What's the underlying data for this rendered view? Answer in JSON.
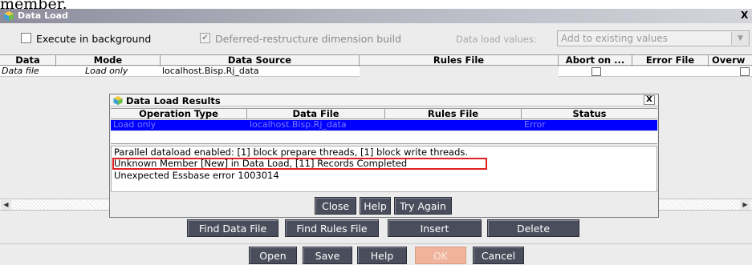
{
  "page_fragment_text": "member.",
  "window": {
    "title": "Data Load",
    "close_glyph": "X"
  },
  "options": {
    "execute_background": "Execute in background",
    "deferred_restructure": "Deferred-restructure dimension build",
    "data_load_values_label": "Data load values:",
    "data_load_values_selected": "Add to existing values",
    "deferred_checked_glyph": "✔"
  },
  "table": {
    "columns": [
      "Data Sou...",
      "Mode",
      "Data Source",
      "Rules File",
      "Abort on ...",
      "Error File",
      "Overw"
    ],
    "rows": [
      {
        "data_source_type": "Data file",
        "mode": "Load only",
        "data_source": "localhost.Bisp.Rj_data",
        "rules_file": ""
      }
    ]
  },
  "buttons_row1": [
    "Find Data File",
    "Find Rules File",
    "Insert",
    "Delete"
  ],
  "buttons_row2": [
    "Open",
    "Save",
    "Help",
    "OK",
    "Cancel"
  ],
  "dialog": {
    "title": "Data Load Results",
    "close_glyph": "X",
    "columns": [
      "Operation Type",
      "Data File",
      "Rules File",
      "Status"
    ],
    "row": {
      "operation_type": "Load only",
      "data_file": "localhost.Bisp.Rj_data",
      "rules_file": "",
      "status": "Error"
    },
    "messages": [
      "Parallel dataload enabled: [1] block prepare threads, [1] block write threads.",
      "Unknown Member [New] in Data Load, [11] Records Completed",
      "Unexpected Essbase error 1003014"
    ],
    "buttons": [
      "Close",
      "Help",
      "Try Again"
    ]
  },
  "colors": {
    "selection_row": "#0000ff",
    "button_bg": "#4a4e5c",
    "ok_disabled": "#f0b49c",
    "highlight_box": "#e02020"
  }
}
